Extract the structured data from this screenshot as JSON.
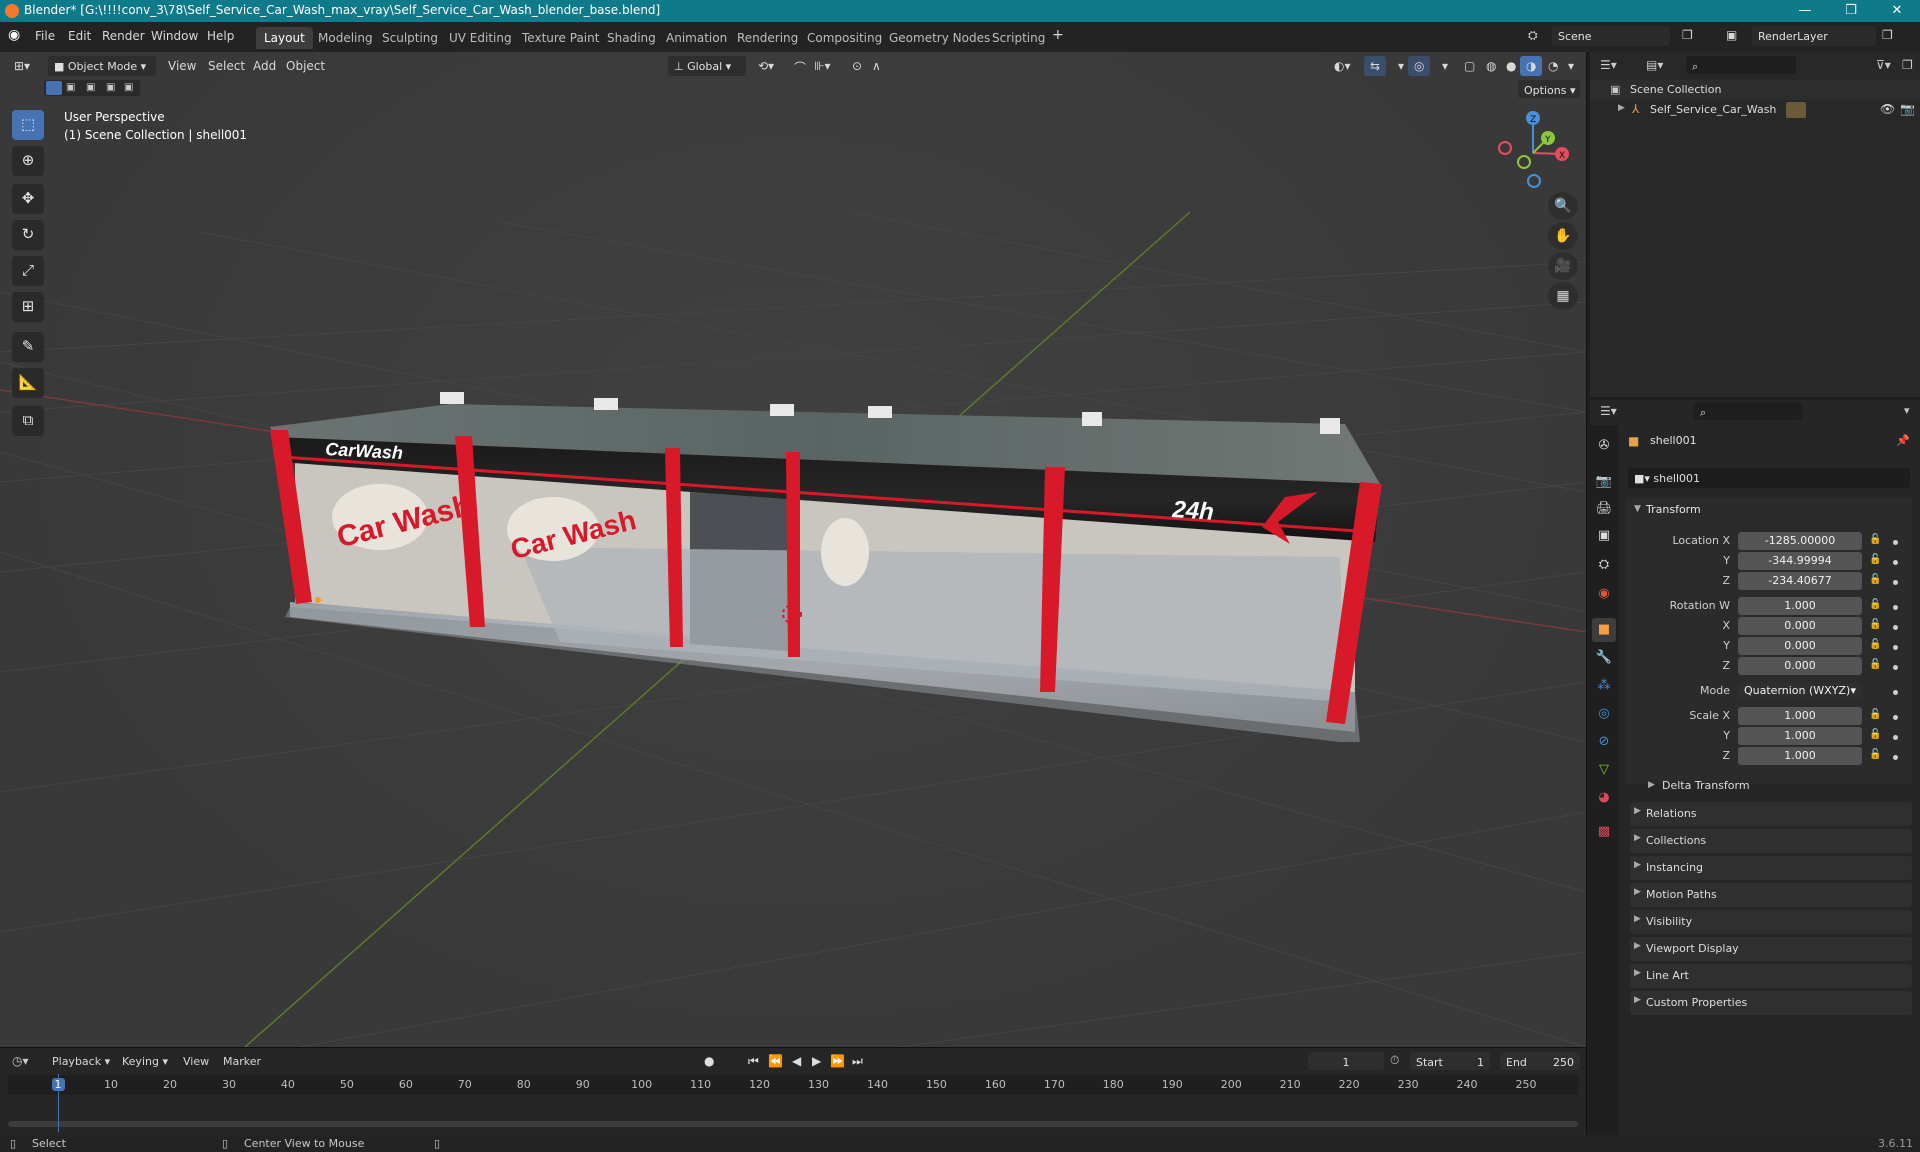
{
  "window": {
    "title": "Blender* [G:\\!!!!conv_3\\78\\Self_Service_Car_Wash_max_vray\\Self_Service_Car_Wash_blender_base.blend]",
    "minimize": "—",
    "maximize": "❐",
    "close": "✕"
  },
  "menus": [
    "File",
    "Edit",
    "Render",
    "Window",
    "Help"
  ],
  "workspaces": [
    "Layout",
    "Modeling",
    "Sculpting",
    "UV Editing",
    "Texture Paint",
    "Shading",
    "Animation",
    "Rendering",
    "Compositing",
    "Geometry Nodes",
    "Scripting"
  ],
  "active_workspace": "Layout",
  "scene_field": "Scene",
  "view_layer_field": "RenderLayer",
  "viewport_header": {
    "mode": "Object Mode",
    "menus": [
      "View",
      "Select",
      "Add",
      "Object"
    ],
    "orientation": "Global",
    "options": "Options"
  },
  "viewport_overlay": {
    "line1": "User Perspective",
    "line2": "(1) Scene Collection | shell001"
  },
  "gizmo": {
    "x": "X",
    "y": "Y",
    "z": "Z"
  },
  "model_text": {
    "sign1": "CarWash",
    "sign2": "24h",
    "banner": "Car Wash"
  },
  "outliner": {
    "root": "Scene Collection",
    "items": [
      "Self_Service_Car_Wash"
    ]
  },
  "properties": {
    "object_name": "shell001",
    "data_name": "shell001",
    "transform_header": "Transform",
    "location_label": "Location X",
    "location": [
      "-1285.00000",
      "-344.99994",
      "-234.40677"
    ],
    "rotation_label": "Rotation W",
    "rotation": [
      "1.000",
      "0.000",
      "0.000",
      "0.000"
    ],
    "mode_label": "Mode",
    "mode_value": "Quaternion (WXYZ)",
    "scale_label": "Scale X",
    "scale": [
      "1.000",
      "1.000",
      "1.000"
    ],
    "axis_labels": [
      "Y",
      "Z",
      "X"
    ],
    "delta": "Delta Transform",
    "sections": [
      "Relations",
      "Collections",
      "Instancing",
      "Motion Paths",
      "Visibility",
      "Viewport Display",
      "Line Art",
      "Custom Properties"
    ]
  },
  "timeline": {
    "menus": [
      "Playback",
      "Keying",
      "View",
      "Marker"
    ],
    "current_frame": "1",
    "start_label": "Start",
    "start": "1",
    "end_label": "End",
    "end": "250",
    "ticks": [
      "1",
      "10",
      "20",
      "30",
      "40",
      "50",
      "60",
      "70",
      "80",
      "90",
      "100",
      "110",
      "120",
      "130",
      "140",
      "150",
      "160",
      "170",
      "180",
      "190",
      "200",
      "210",
      "220",
      "230",
      "240",
      "250"
    ]
  },
  "status": {
    "select": "Select",
    "center": "Center View to Mouse",
    "version": "3.6.11"
  },
  "colors": {
    "title_bar": "#0e7a8a",
    "accent": "#4772b3",
    "x_axis": "#e44d5e",
    "y_axis": "#8cc63f",
    "z_axis": "#4a90d9",
    "brand_red": "#d7192a"
  }
}
